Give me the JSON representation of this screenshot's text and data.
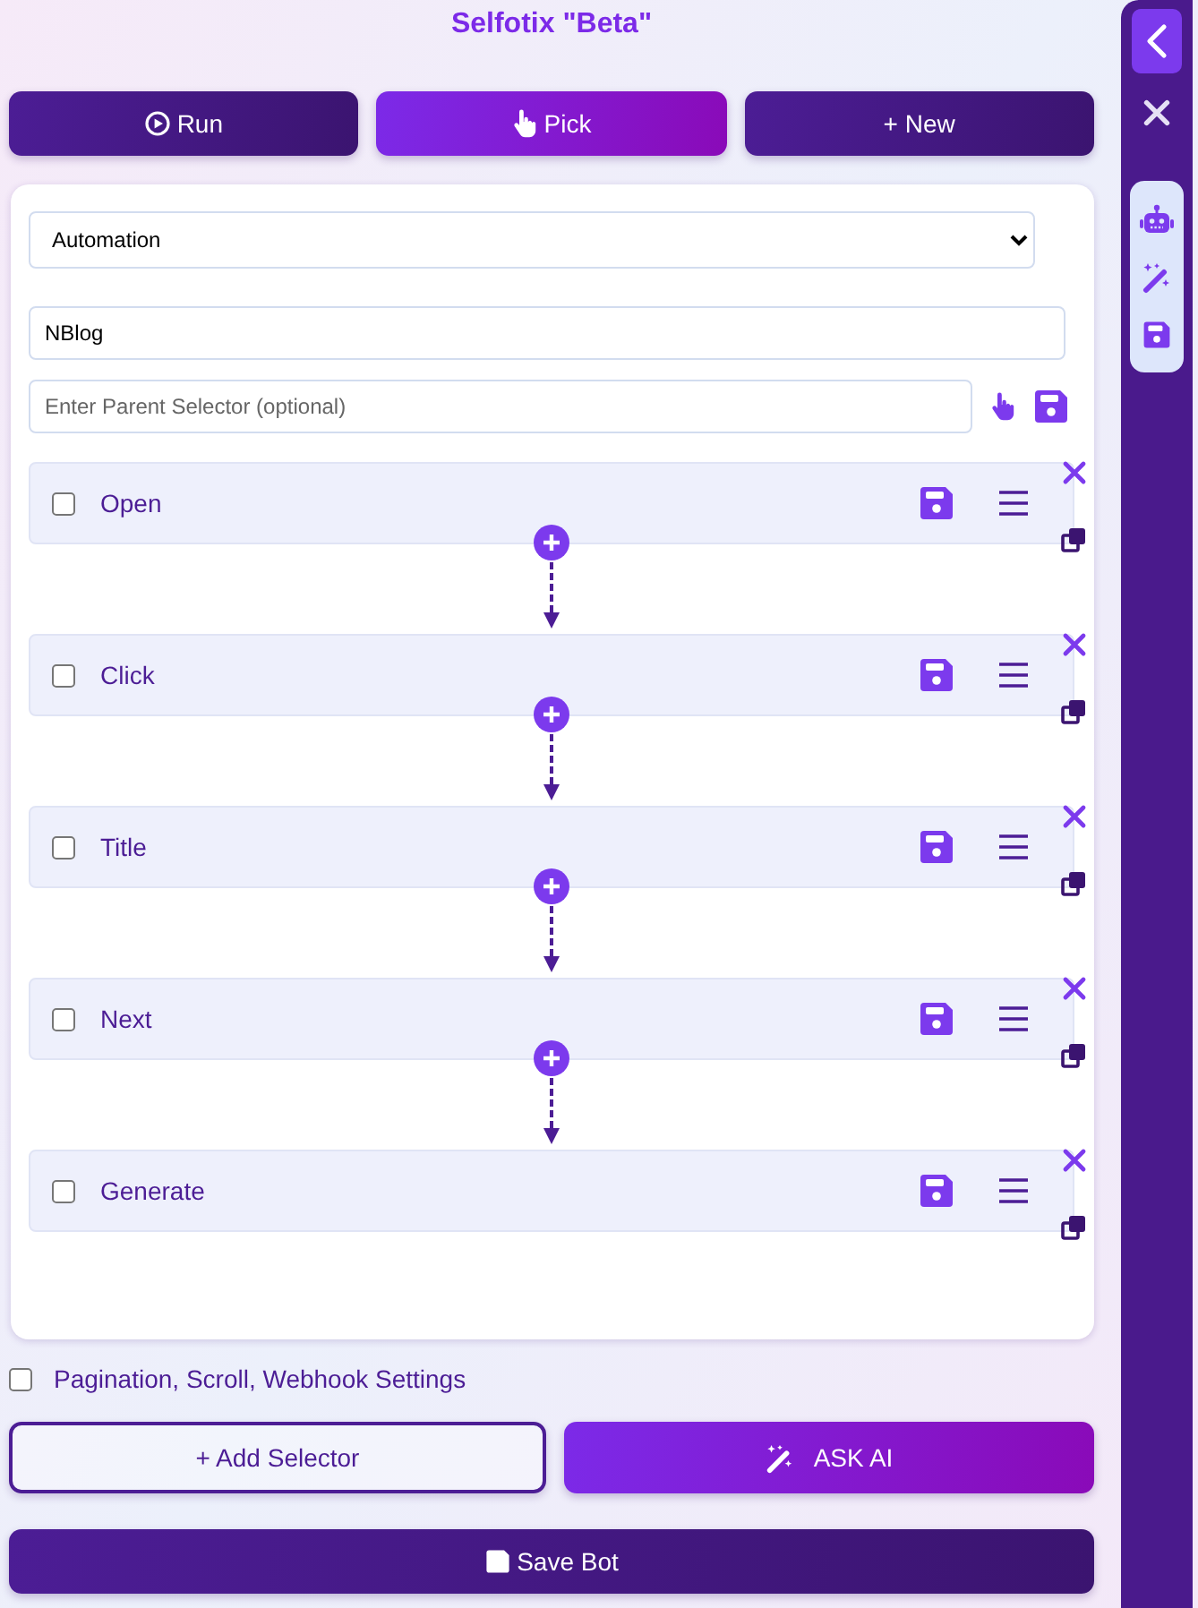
{
  "title": "Selfotix \"Beta\"",
  "toolbar": [
    {
      "kind": "run",
      "label": "Run",
      "selected": false
    },
    {
      "kind": "pick",
      "label": "Pick",
      "selected": true
    },
    {
      "kind": "new",
      "label": "+ New",
      "selected": false
    }
  ],
  "mode_select": {
    "value": "Automation"
  },
  "name_field": {
    "value": "NBlog"
  },
  "parent_selector": {
    "placeholder": "Enter Parent Selector (optional)"
  },
  "steps": [
    {
      "label": "Open",
      "checked": false
    },
    {
      "label": "Click",
      "checked": false
    },
    {
      "label": "Title",
      "checked": false
    },
    {
      "label": "Next",
      "checked": false
    },
    {
      "label": "Generate",
      "checked": false
    }
  ],
  "settings_toggle": {
    "label": "Pagination, Scroll, Webhook Settings",
    "checked": false
  },
  "add_selector_button": "+ Add Selector",
  "ask_ai_button": "ASK AI",
  "save_bot_button": "Save Bot"
}
